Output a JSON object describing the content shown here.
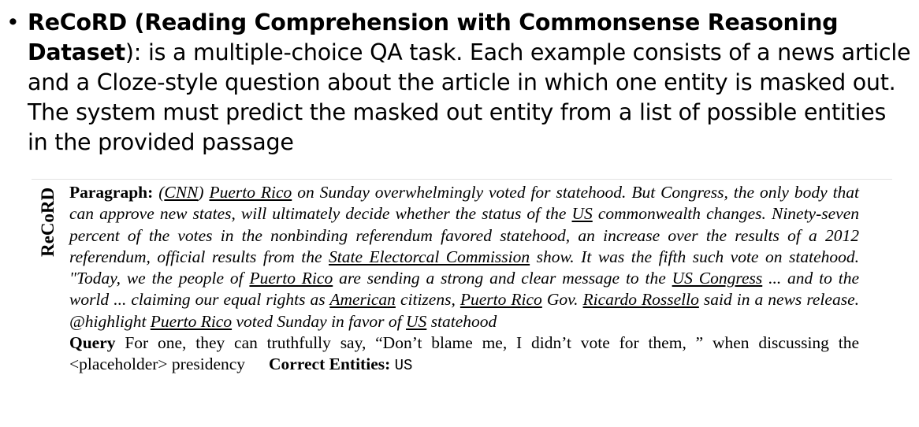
{
  "bullet": {
    "marker": "•",
    "title_bold": "ReCoRD (Reading Comprehension with Commonsense Reasoning Dataset",
    "title_paren": ")",
    "description": ":  is a multiple-choice QA task. Each example consists of a news article and a Cloze-style question about the article in which one entity is masked out. The system must predict the masked out entity from a list of possible entities in the provided passage"
  },
  "figure": {
    "side_label": "ReCoRD",
    "paragraph_label": "Paragraph:",
    "paragraph_segments": [
      {
        "text": "(",
        "u": false
      },
      {
        "text": "CNN",
        "u": true
      },
      {
        "text": ") ",
        "u": false
      },
      {
        "text": "Puerto Rico",
        "u": true
      },
      {
        "text": " on Sunday overwhelmingly voted for statehood. But Congress, the only body that can approve new states, will ultimately decide whether the status of the ",
        "u": false
      },
      {
        "text": "US",
        "u": true
      },
      {
        "text": " commonwealth changes. Ninety-seven percent of the votes in the nonbinding referendum favored statehood, an increase over the results of a 2012 referendum, official results from the ",
        "u": false
      },
      {
        "text": "State Electorcal Commission",
        "u": true
      },
      {
        "text": " show.  It was the fifth such vote on statehood.  \"Today, we the people of ",
        "u": false
      },
      {
        "text": "Puerto Rico",
        "u": true
      },
      {
        "text": " are sending a strong and clear message to the ",
        "u": false
      },
      {
        "text": "US Congress",
        "u": true
      },
      {
        "text": " ... and to the world ... claiming our equal rights as ",
        "u": false
      },
      {
        "text": "American",
        "u": true
      },
      {
        "text": " citizens, ",
        "u": false
      },
      {
        "text": "Puerto Rico",
        "u": true
      },
      {
        "text": " Gov.  ",
        "u": false
      },
      {
        "text": "Ricardo Rossello",
        "u": true
      },
      {
        "text": " said in a news release.  @highlight ",
        "u": false
      },
      {
        "text": "Puerto Rico",
        "u": true
      },
      {
        "text": " voted Sunday in favor of ",
        "u": false
      },
      {
        "text": "US",
        "u": true
      },
      {
        "text": " statehood",
        "u": false
      }
    ],
    "query_label": "Query",
    "query_text": " For one, they can truthfully say, “Don’t blame me, I didn’t vote for them, ” when discussing the <placeholder> presidency",
    "answer_label": "Correct Entities:",
    "answer_value": "US"
  }
}
